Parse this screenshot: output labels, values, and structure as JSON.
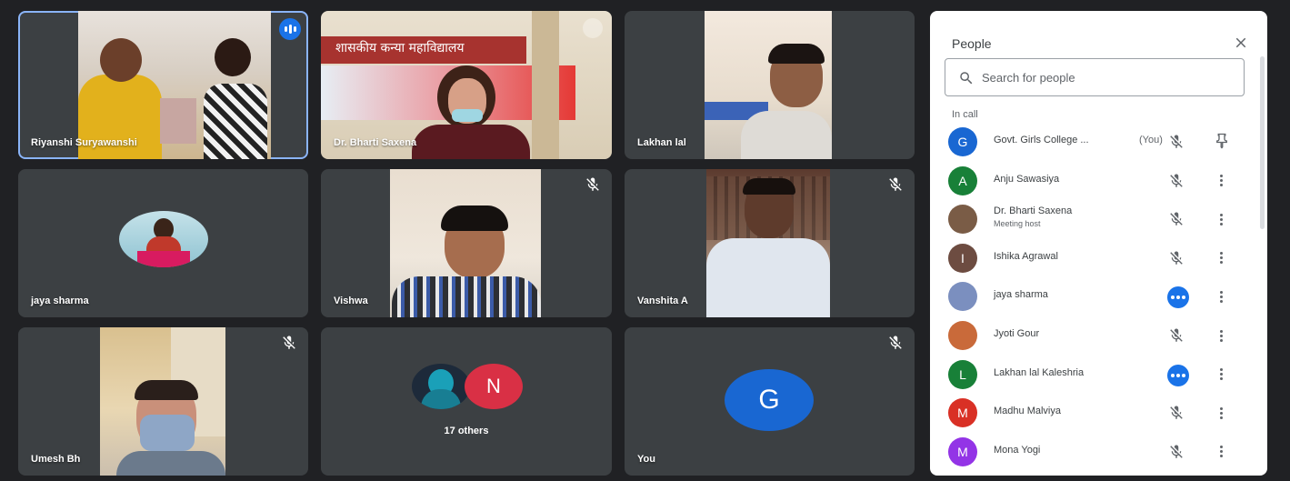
{
  "tiles": [
    {
      "name": "Riyanshi Suryawanshi"
    },
    {
      "name": "Dr. Bharti Saxena"
    },
    {
      "name": "Lakhan lal"
    },
    {
      "name": "jaya sharma"
    },
    {
      "name": "Vishwa"
    },
    {
      "name": "Vanshita A"
    },
    {
      "name": "Umesh Bh"
    },
    {
      "name": "17 others",
      "avatar_letter": "N"
    },
    {
      "name": "You",
      "avatar_letter": "G"
    }
  ],
  "banner_text": "शासकीय कन्या महाविद्यालय",
  "panel": {
    "title": "People",
    "search_placeholder": "Search for people",
    "section": "In call",
    "people": [
      {
        "name": "Govt. Girls College ...",
        "suffix": "(You)",
        "letter": "G",
        "color": "#1967d2",
        "status": "muted",
        "action": "pin"
      },
      {
        "name": "Anju Sawasiya",
        "letter": "A",
        "color": "#188038",
        "status": "muted",
        "action": "more"
      },
      {
        "name": "Dr. Bharti Saxena",
        "subtitle": "Meeting host",
        "letter": "",
        "color": "#7a5c46",
        "status": "muted",
        "action": "more"
      },
      {
        "name": "Ishika Agrawal",
        "letter": "I",
        "color": "#6d4c41",
        "status": "muted",
        "action": "more"
      },
      {
        "name": "jaya sharma",
        "letter": "",
        "color": "#7b8fbf",
        "status": "talking",
        "action": "more"
      },
      {
        "name": "Jyoti Gour",
        "letter": "",
        "color": "#c96a3a",
        "status": "muted",
        "action": "more"
      },
      {
        "name": "Lakhan lal Kaleshria",
        "letter": "L",
        "color": "#188038",
        "status": "talking",
        "action": "more"
      },
      {
        "name": "Madhu Malviya",
        "letter": "M",
        "color": "#d93025",
        "status": "muted",
        "action": "more"
      },
      {
        "name": "Mona Yogi",
        "letter": "M",
        "color": "#9334e6",
        "status": "muted",
        "action": "more"
      }
    ]
  }
}
